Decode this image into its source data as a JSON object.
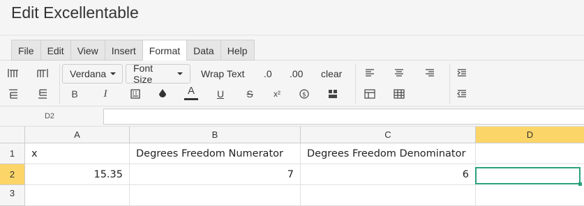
{
  "window": {
    "title": "Edit Excellentable"
  },
  "menu": [
    "File",
    "Edit",
    "View",
    "Insert",
    "Format",
    "Data",
    "Help"
  ],
  "active_menu": "Format",
  "toolbar": {
    "font_family": "Verdana",
    "font_size": "Font Size",
    "wrap_text": "Wrap Text",
    "decimal_one": ".0",
    "decimal_two": ".00",
    "clear": "clear",
    "bold": "B",
    "italic": "I",
    "text_color": "A",
    "underline": "U",
    "strike": "S",
    "superscript": "x²",
    "text_color_bar": "#333333"
  },
  "formula_bar": {
    "cell_ref": "D2",
    "formula": ""
  },
  "sheet": {
    "columns": [
      "A",
      "B",
      "C",
      "D"
    ],
    "rows": [
      "1",
      "2",
      "3"
    ],
    "selected_column": "D",
    "selected_row": "2",
    "cells": {
      "A1": "x",
      "B1": "Degrees Freedom Numerator",
      "C1": "Degrees Freedom Denominator",
      "A2": "15.35",
      "B2": "7",
      "C2": "6"
    },
    "accent_color": "#2aa17c",
    "header_highlight": "#fbd568"
  }
}
